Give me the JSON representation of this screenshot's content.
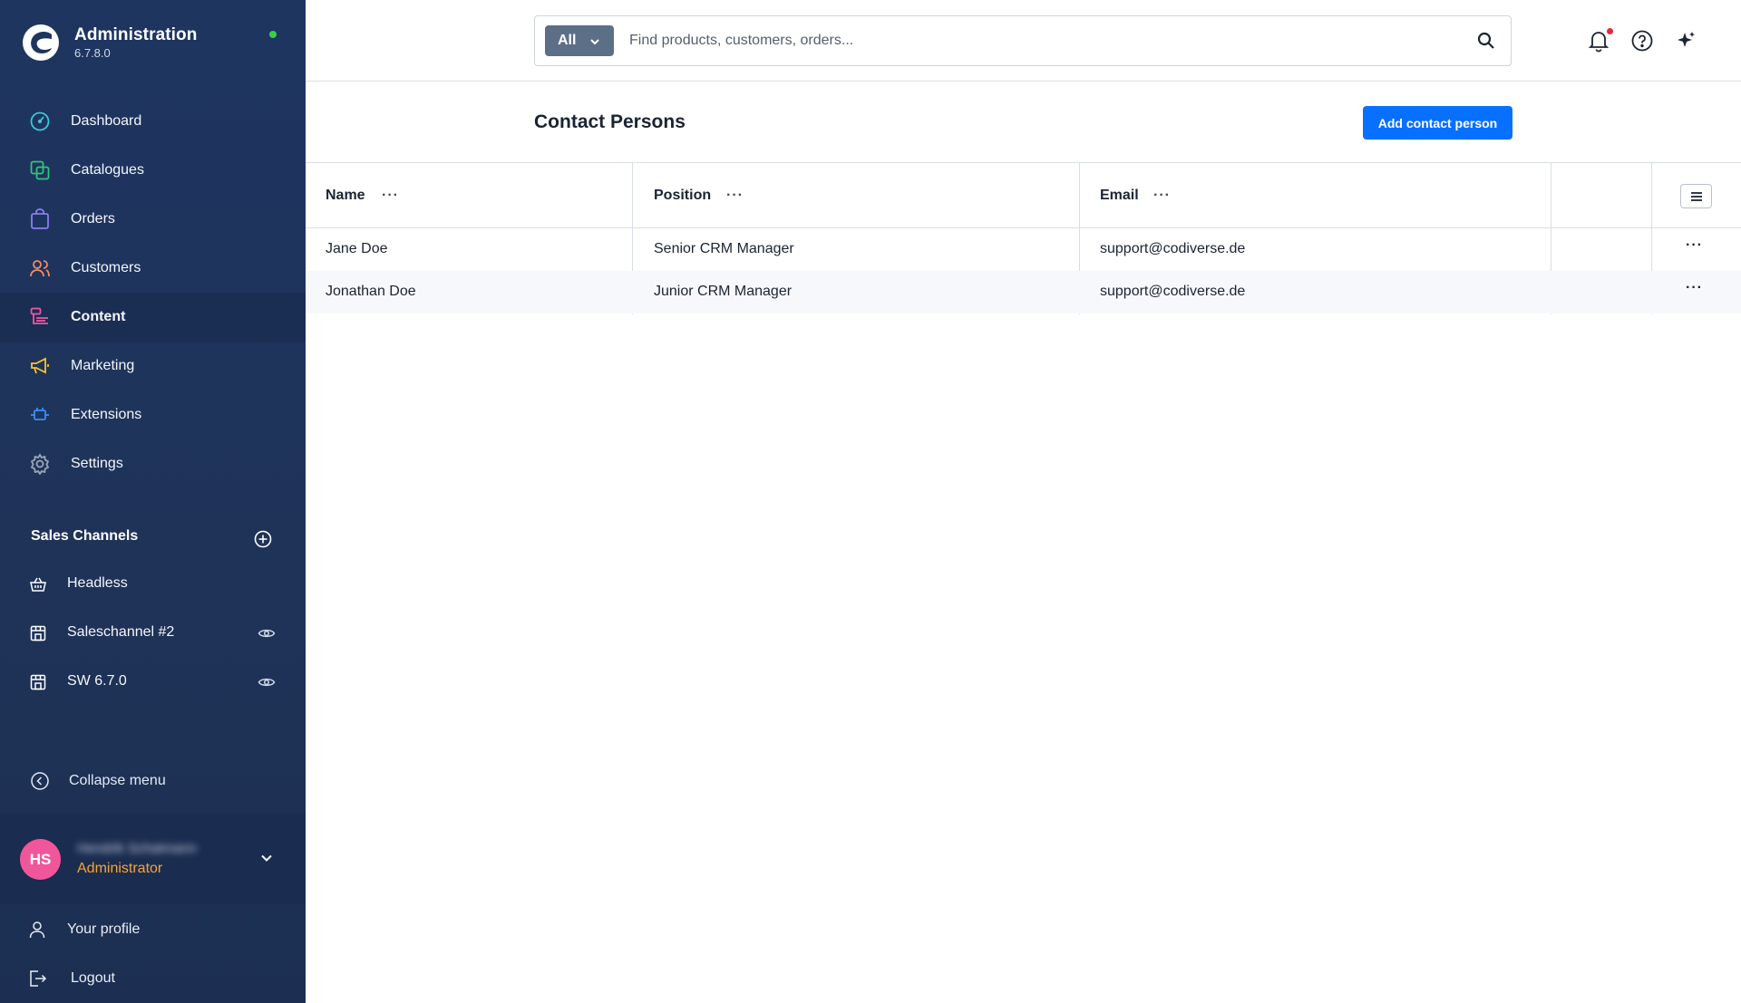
{
  "app": {
    "title": "Administration",
    "version": "6.7.8.0",
    "status_color": "#37d046"
  },
  "sidebar": {
    "nav": [
      {
        "label": "Dashboard",
        "icon": "dashboard-icon",
        "color": "#3fc6d9"
      },
      {
        "label": "Catalogues",
        "icon": "catalogues-icon",
        "color": "#33c27b"
      },
      {
        "label": "Orders",
        "icon": "orders-icon",
        "color": "#8b7cf6"
      },
      {
        "label": "Customers",
        "icon": "customers-icon",
        "color": "#f58a62"
      },
      {
        "label": "Content",
        "icon": "content-icon",
        "color": "#e75aa3",
        "active": true
      },
      {
        "label": "Marketing",
        "icon": "marketing-icon",
        "color": "#f4c430"
      },
      {
        "label": "Extensions",
        "icon": "extensions-icon",
        "color": "#3a8ef5"
      },
      {
        "label": "Settings",
        "icon": "settings-icon",
        "color": "#9aa6b8"
      }
    ],
    "sales_channels": {
      "title": "Sales Channels",
      "items": [
        {
          "label": "Headless",
          "icon": "basket-icon",
          "visible_toggle": false
        },
        {
          "label": "Saleschannel #2",
          "icon": "storefront-icon",
          "visible_toggle": true
        },
        {
          "label": "SW 6.7.0",
          "icon": "storefront-icon",
          "visible_toggle": true
        }
      ]
    },
    "collapse_label": "Collapse menu",
    "user": {
      "initials": "HS",
      "name": "Hendrik Schatmann",
      "role": "Administrator",
      "avatar_color": "#f0569a"
    },
    "profile_label": "Your profile",
    "logout_label": "Logout"
  },
  "search": {
    "type_label": "All",
    "placeholder": "Find products, customers, orders..."
  },
  "page": {
    "title": "Contact Persons",
    "add_button": "Add contact person",
    "accent": "#0870ff"
  },
  "table": {
    "columns": [
      "Name",
      "Position",
      "Email"
    ],
    "rows": [
      {
        "name": "Jane Doe",
        "position": "Senior CRM Manager",
        "email": "support@codiverse.de"
      },
      {
        "name": "Jonathan Doe",
        "position": "Junior CRM Manager",
        "email": "support@codiverse.de"
      }
    ]
  }
}
